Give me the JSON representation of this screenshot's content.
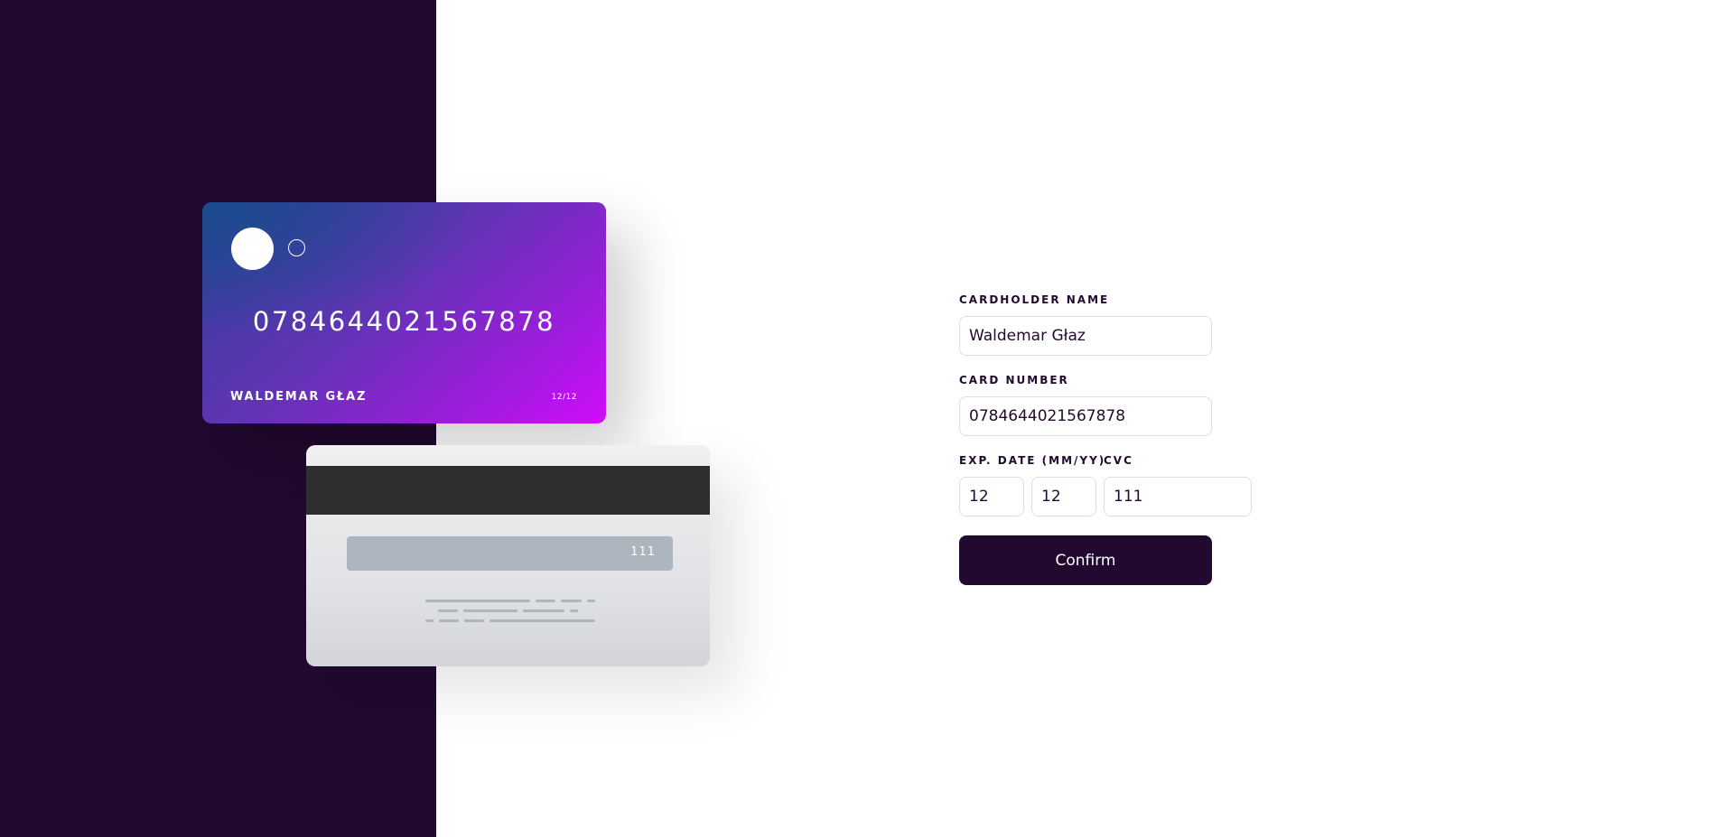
{
  "card_front": {
    "number": "0784644021567878",
    "holder": "WALDEMAR GŁAZ",
    "expiry": "12/12"
  },
  "card_back": {
    "cvc": "111"
  },
  "form": {
    "name_label": "CARDHOLDER NAME",
    "name_value": "Waldemar Głaz",
    "number_label": "CARD NUMBER",
    "number_value": "0784644021567878",
    "exp_label": "EXP. DATE (MM/YY)",
    "exp_month": "12",
    "exp_year": "12",
    "cvc_label": "CVC",
    "cvc_value": "111",
    "confirm_label": "Confirm"
  },
  "colors": {
    "panel": "#21092f",
    "accent_start": "#2f3f99",
    "accent_end": "#d20cfb",
    "input_border": "#dedddf",
    "button": "#21092f"
  }
}
